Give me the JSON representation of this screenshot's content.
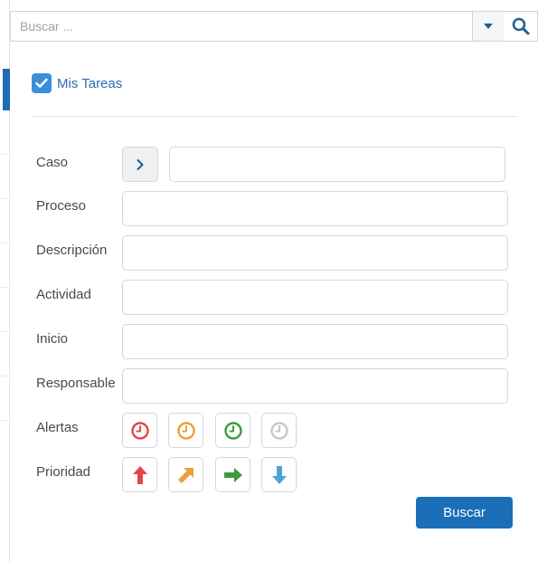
{
  "search": {
    "placeholder": "Buscar ...",
    "value": ""
  },
  "filters": {
    "mis_tareas_label": "Mis Tareas",
    "mis_tareas_checked": true,
    "fields": {
      "caso": "Caso",
      "proceso": "Proceso",
      "descripcion": "Descripción",
      "actividad": "Actividad",
      "inicio": "Inicio",
      "responsable": "Responsable",
      "alertas": "Alertas",
      "prioridad": "Prioridad"
    },
    "alert_icons": [
      {
        "name": "alert-overdue-clock-icon",
        "color": "#e0474c"
      },
      {
        "name": "alert-warning-clock-icon",
        "color": "#e9a23b"
      },
      {
        "name": "alert-ontime-clock-icon",
        "color": "#3f9b3f"
      },
      {
        "name": "alert-none-clock-icon",
        "color": "#c6c9cc"
      }
    ],
    "priority_icons": [
      {
        "name": "priority-high-arrow-up-icon",
        "color": "#e0474c"
      },
      {
        "name": "priority-medium-arrow-diagonal-icon",
        "color": "#e9a23b"
      },
      {
        "name": "priority-normal-arrow-right-icon",
        "color": "#3f9b3f"
      },
      {
        "name": "priority-low-arrow-down-icon",
        "color": "#4aa6d6"
      }
    ]
  },
  "actions": {
    "buscar_label": "Buscar"
  },
  "colors": {
    "accent": "#1a6fb8",
    "checkbox": "#3b8fd9"
  }
}
